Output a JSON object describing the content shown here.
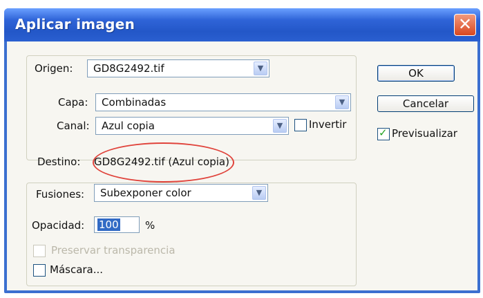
{
  "window": {
    "title": "Aplicar imagen",
    "close_glyph": "✕"
  },
  "origen": {
    "label": "Origen:",
    "file_value": "GD8G2492.tif",
    "capa_label": "Capa:",
    "capa_value": "Combinadas",
    "canal_label": "Canal:",
    "canal_value": "Azul copia",
    "invertir_label": "Invertir",
    "invertir_checked": false
  },
  "destino": {
    "label": "Destino:",
    "value": "GD8G2492.tif (Azul copia)"
  },
  "fusiones": {
    "label": "Fusiones:",
    "value": "Subexponer color",
    "opacidad_label": "Opacidad:",
    "opacidad_value": "100",
    "opacidad_unit": "%",
    "preservar_label": "Preservar transparencia",
    "preservar_enabled": false,
    "mascara_label": "Máscara...",
    "mascara_checked": false
  },
  "buttons": {
    "ok_label": "OK",
    "cancel_label": "Cancelar"
  },
  "previsualizar": {
    "label": "Previsualizar",
    "checked": true
  },
  "icons": {
    "dropdown": "chevron-down-icon",
    "close": "close-icon",
    "check": "checkmark-icon"
  },
  "colors": {
    "titlebar": "#2357c8",
    "highlight_annotation": "#e0433b",
    "selection": "#316ac5"
  }
}
